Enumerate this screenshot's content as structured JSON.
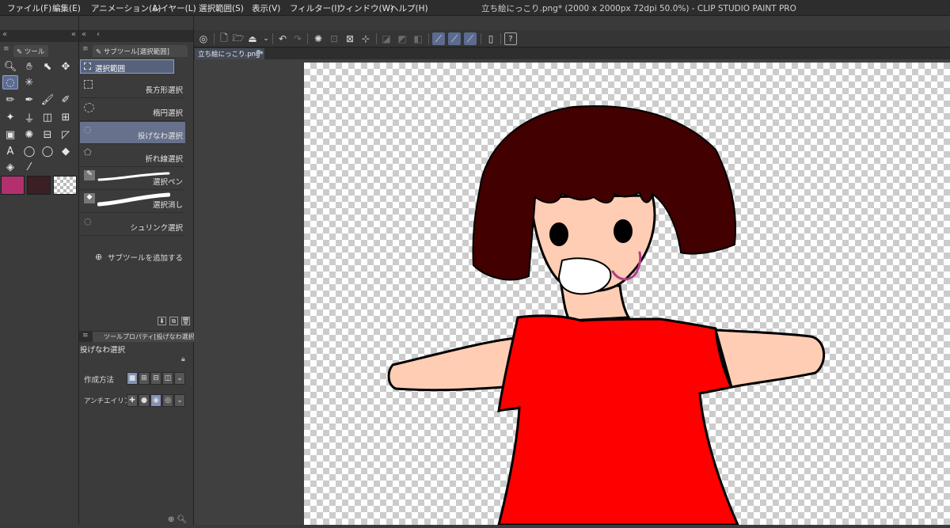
{
  "window": {
    "title": "立ち絵にっこり.png* (2000 x 2000px 72dpi 50.0%)  - CLIP STUDIO PAINT PRO"
  },
  "menu": [
    "ファイル(F)",
    "編集(E)",
    "アニメーション(A)",
    "レイヤー(L)",
    "選択範囲(S)",
    "表示(V)",
    "フィルター(I)",
    "ウィンドウ(W)",
    "ヘルプ(H)"
  ],
  "panels": {
    "tool_tab": "ツール",
    "subtool_tab": "サブツール[選択範囲]",
    "subtool_group": "選択範囲",
    "subtools": [
      {
        "label": "長方形選択",
        "icon": "rect-select-icon"
      },
      {
        "label": "楕円選択",
        "icon": "ellipse-select-icon"
      },
      {
        "label": "投げなわ選択",
        "icon": "lasso-select-icon",
        "selected": true
      },
      {
        "label": "折れ線選択",
        "icon": "polyline-select-icon"
      },
      {
        "label": "選択ペン",
        "icon": "select-pen-icon"
      },
      {
        "label": "選択消し",
        "icon": "select-erase-icon"
      },
      {
        "label": "シュリンク選択",
        "icon": "shrink-select-icon"
      }
    ],
    "add_subtool": "サブツールを追加する",
    "property_tab": "ツールプロパティ[投げなわ選択]",
    "property_title": "投げなわ選択",
    "property_rows": [
      {
        "label": "作成方法"
      },
      {
        "label": "アンチエイリアス"
      }
    ]
  },
  "document": {
    "tab": "立ち絵にっこり.png*"
  },
  "colors": {
    "main_color": "#b3306e",
    "sub_color": "#3a1f24",
    "accent": "#5b6c90",
    "dress": "#ff0000",
    "hair": "#420000",
    "skin": "#ffcdb3",
    "smile": "#b23c8a"
  }
}
